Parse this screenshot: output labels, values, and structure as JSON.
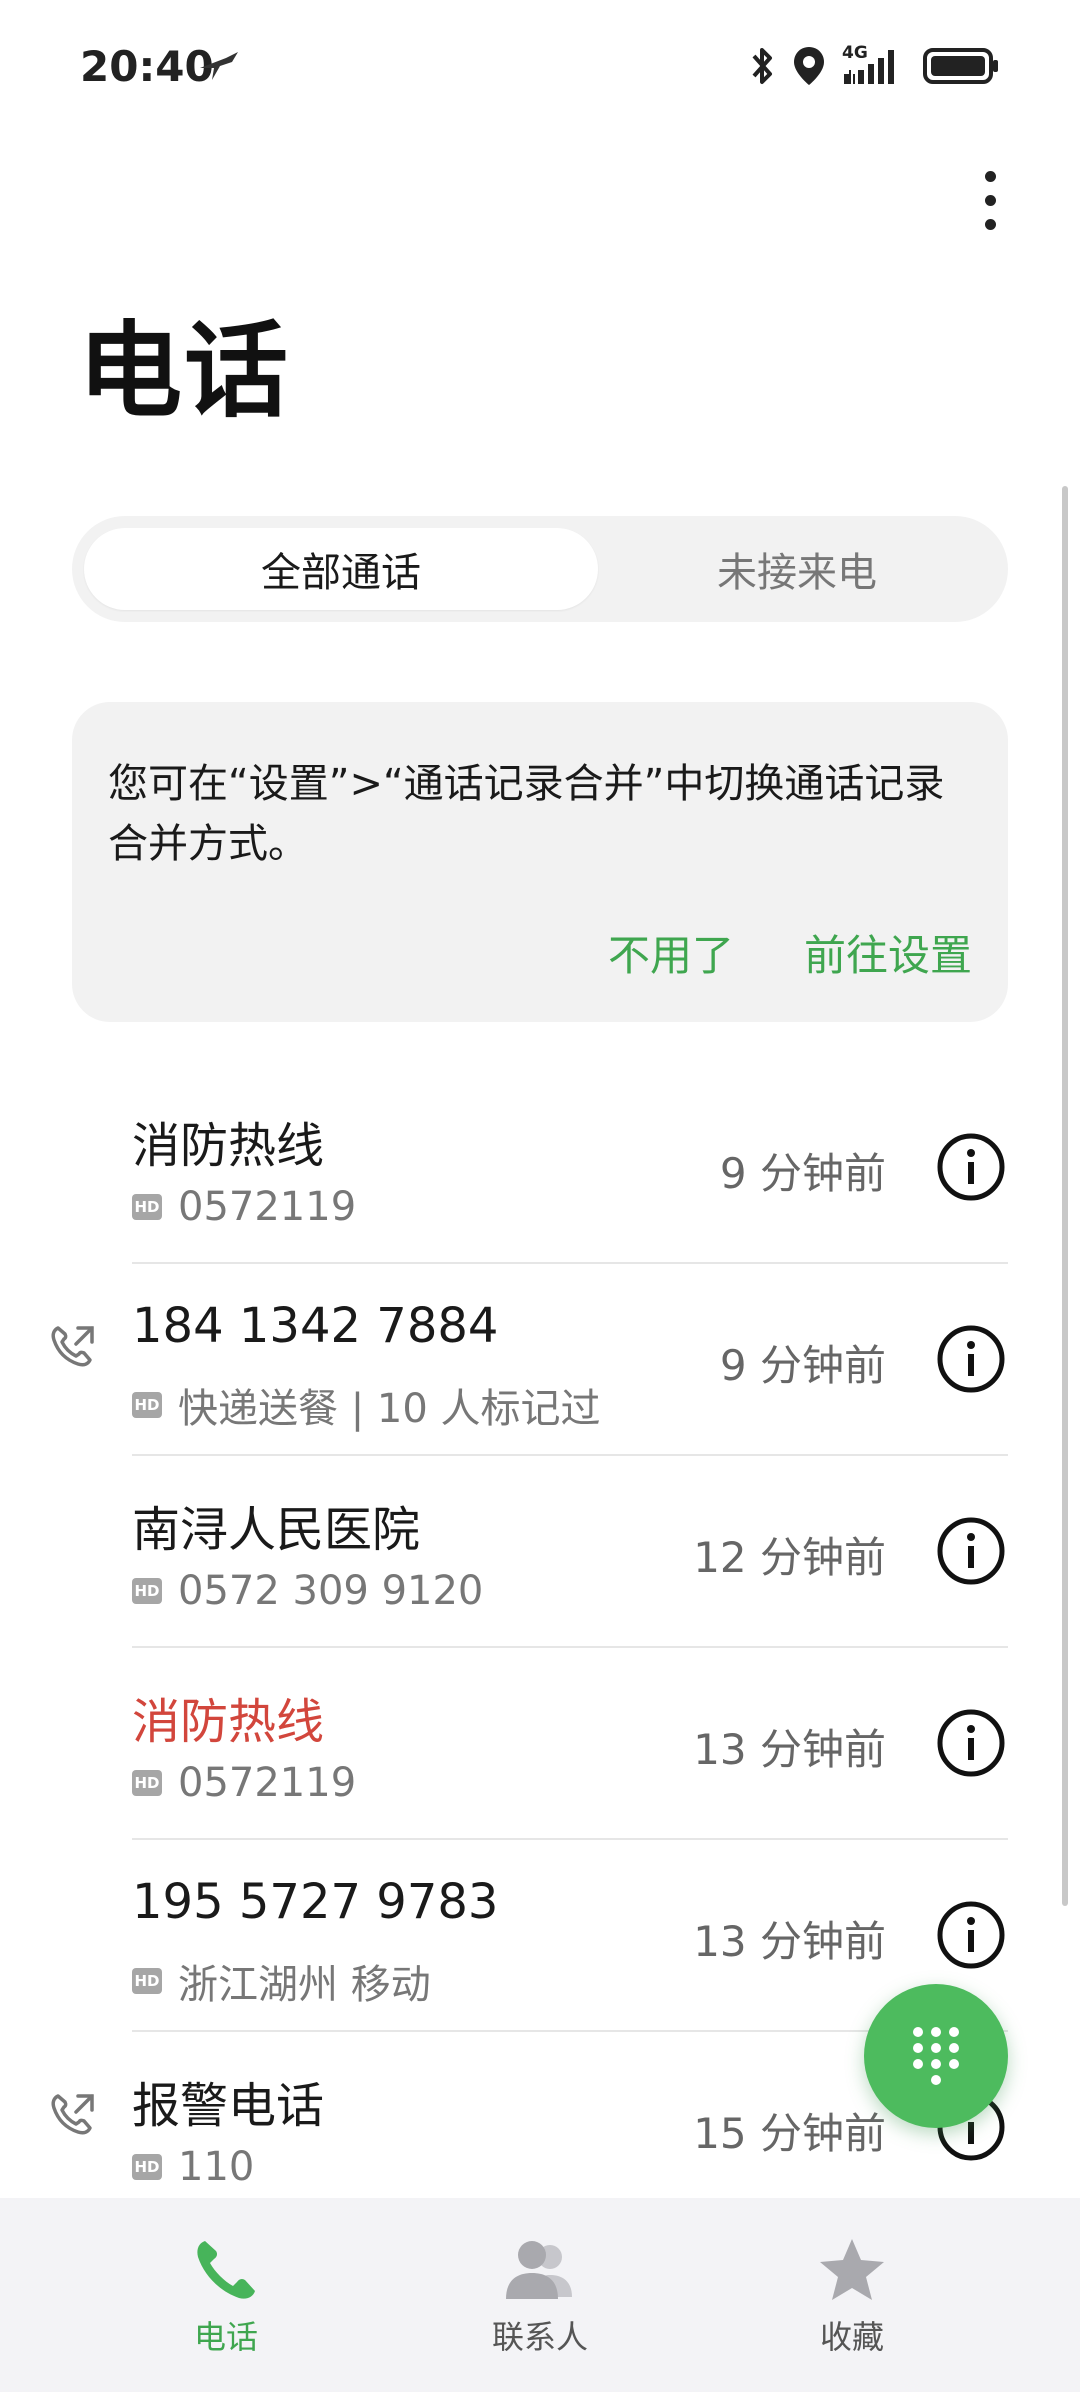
{
  "status_bar": {
    "time": "20:40",
    "network": "4G"
  },
  "page_title": "电话",
  "tabs": [
    {
      "label": "全部通话",
      "active": true
    },
    {
      "label": "未接来电",
      "active": false
    }
  ],
  "notice": {
    "text": "您可在“设置”>“通话记录合并”中切换通话记录合并方式。",
    "dismiss_label": "不用了",
    "goto_label": "前往设置"
  },
  "calls": [
    {
      "name": "消防热线",
      "detail": "0572119",
      "time": "9 分钟前",
      "missed": false,
      "outgoing": false
    },
    {
      "name": "184 1342 7884",
      "detail": "快递送餐 | 10 人标记过",
      "time": "9 分钟前",
      "missed": false,
      "outgoing": true
    },
    {
      "name": "南浔人民医院",
      "detail": "0572 309 9120",
      "time": "12 分钟前",
      "missed": false,
      "outgoing": false
    },
    {
      "name": "消防热线",
      "detail": "0572119",
      "time": "13 分钟前",
      "missed": true,
      "outgoing": false
    },
    {
      "name": "195 5727 9783",
      "detail": "浙江湖州 移动",
      "time": "13 分钟前",
      "missed": false,
      "outgoing": false
    },
    {
      "name": "报警电话",
      "detail": "110",
      "time": "15 分钟前",
      "missed": false,
      "outgoing": true
    }
  ],
  "hd_badge": "HD",
  "bottom_nav": [
    {
      "label": "电话",
      "icon": "phone-icon",
      "active": true
    },
    {
      "label": "联系人",
      "icon": "contacts-icon",
      "active": false
    },
    {
      "label": "收藏",
      "icon": "star-icon",
      "active": false
    }
  ],
  "colors": {
    "accent": "#3fa64f",
    "missed": "#d2463c",
    "fab": "#4dbb5e"
  }
}
